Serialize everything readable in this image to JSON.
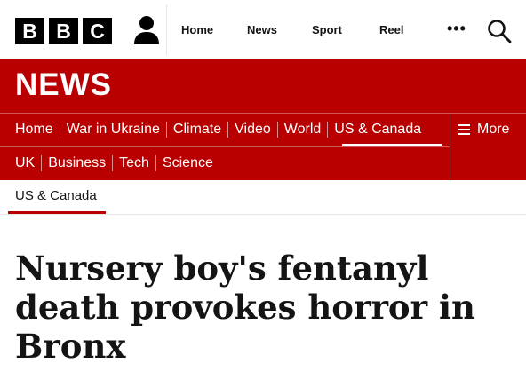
{
  "header": {
    "logo_letters": [
      "B",
      "B",
      "C"
    ],
    "nav": [
      "Home",
      "News",
      "Sport",
      "Reel"
    ],
    "more_label": "•••"
  },
  "news": {
    "title": "NEWS",
    "primary_nav": [
      "Home",
      "War in Ukraine",
      "Climate",
      "Video",
      "World",
      "US & Canada"
    ],
    "active_item": "US & Canada",
    "secondary_nav": [
      "UK",
      "Business",
      "Tech",
      "Science"
    ],
    "more_label": "More"
  },
  "section": {
    "label": "US & Canada"
  },
  "article": {
    "headline": "Nursery boy's fentanyl death provokes horror in Bronx"
  },
  "colors": {
    "brand_red": "#b80000",
    "text": "#141414"
  },
  "icons": {
    "account": "person-icon",
    "search": "magnifier-icon",
    "menu": "hamburger-icon"
  }
}
